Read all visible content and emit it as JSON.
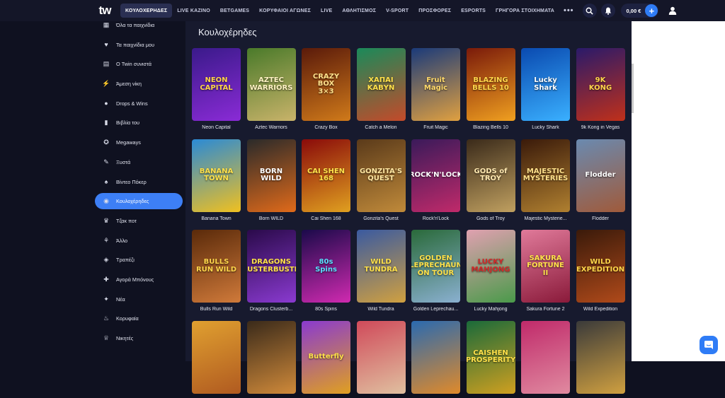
{
  "header": {
    "logo": "tw",
    "nav": [
      {
        "label": "ΚΟΥΛΟΧΕΡΗΔΕΣ",
        "active": true
      },
      {
        "label": "LIVE ΚΑΖΙΝΟ"
      },
      {
        "label": "BETGAMES"
      },
      {
        "label": "ΚΟΡΥΦΑΙΟΙ ΑΓΩΝΕΣ"
      },
      {
        "label": "LIVE"
      },
      {
        "label": "ΑΘΛΗΤΙΣΜΟΣ"
      },
      {
        "label": "V-SPORT"
      },
      {
        "label": "ΠΡΟΣΦΟΡΕΣ"
      },
      {
        "label": "ESPORTS"
      },
      {
        "label": "ΓΡΗΓΟΡΑ ΣΤΟΙΧΗΜΑΤΑ"
      }
    ],
    "more": "•••",
    "balance": "0,00 €",
    "plus": "+"
  },
  "sidebar": {
    "items": [
      {
        "label": "Όλα τα παιχνίδια",
        "icon": "grid-icon"
      },
      {
        "label": "Τα παιχνίδια μου",
        "icon": "heart-icon"
      },
      {
        "label": "Ο Twin συνιστά",
        "icon": "reels-icon"
      },
      {
        "label": "Άμεση νίκη",
        "icon": "lightning-icon"
      },
      {
        "label": "Drops & Wins",
        "icon": "drop-icon"
      },
      {
        "label": "Βιβλία του",
        "icon": "book-icon"
      },
      {
        "label": "Megaways",
        "icon": "megaways-icon"
      },
      {
        "label": "Ξυστά",
        "icon": "scratch-icon"
      },
      {
        "label": "Βίντεο Πόκερ",
        "icon": "cards-icon"
      },
      {
        "label": "Κουλοχέρηδες",
        "icon": "slot-icon",
        "active": true
      },
      {
        "label": "Τζακ ποτ",
        "icon": "jackpot-icon"
      },
      {
        "label": "Άλλο",
        "icon": "other-icon"
      },
      {
        "label": "Τραπέζι",
        "icon": "table-icon"
      },
      {
        "label": "Αγορά Μπόνους",
        "icon": "gift-icon"
      },
      {
        "label": "Νέα",
        "icon": "new-icon"
      },
      {
        "label": "Κορυφαία",
        "icon": "fire-icon"
      },
      {
        "label": "Νικητές",
        "icon": "trophy-icon"
      }
    ]
  },
  "main": {
    "title": "Κουλοχέρηδες",
    "games": [
      {
        "name": "Neon Capital",
        "art": "NEON\nCAPITAL",
        "colors": [
          "#3a1a8a",
          "#8a2bd6"
        ],
        "accent": "#ffd54a"
      },
      {
        "name": "Aztec Warriors",
        "art": "AZTEC\nWARRIORS",
        "colors": [
          "#4a7a2a",
          "#c9b36a"
        ],
        "accent": "#fff3c4"
      },
      {
        "name": "Crazy Box",
        "art": "CRAZY\nBOX\n3×3",
        "colors": [
          "#5a1a0a",
          "#d07a1a"
        ],
        "accent": "#ffe08a"
      },
      {
        "name": "Catch a Melon",
        "art": "ΧΑΠΑΙ\nΚΑΒΥΝ",
        "colors": [
          "#1a8a5a",
          "#c44a2a"
        ],
        "accent": "#ffe14a"
      },
      {
        "name": "Fruit Magic",
        "art": "Fruit Magic",
        "colors": [
          "#1a3a7a",
          "#e0a040"
        ],
        "accent": "#ffd96a"
      },
      {
        "name": "Blazing Bells 10",
        "art": "BLAZING\nBELLS 10",
        "colors": [
          "#7a1a0a",
          "#f0a020"
        ],
        "accent": "#ffd54a"
      },
      {
        "name": "Lucky Shark",
        "art": "Lucky\nShark",
        "colors": [
          "#0a4ab0",
          "#3ab0ff"
        ],
        "accent": "#ffffff"
      },
      {
        "name": "9k Kong in Vegas",
        "art": "9K\nKONG",
        "colors": [
          "#2a1a6a",
          "#c0301a"
        ],
        "accent": "#ffd54a"
      },
      {
        "name": "Banana Town",
        "art": "BANANA\nTOWN",
        "colors": [
          "#2a8ad6",
          "#f0c020"
        ],
        "accent": "#ffe14a"
      },
      {
        "name": "Born WILD",
        "art": "BORN WILD",
        "colors": [
          "#2a2a2a",
          "#e06a1a"
        ],
        "accent": "#ffffff"
      },
      {
        "name": "Cai Shen 168",
        "art": "CAI SHEN\n168",
        "colors": [
          "#8a0a0a",
          "#e0a020"
        ],
        "accent": "#ffe14a"
      },
      {
        "name": "Gonzita's Quest",
        "art": "GONZITA'S\nQUEST",
        "colors": [
          "#5a3a1a",
          "#c08a3a"
        ],
        "accent": "#ffe6a0"
      },
      {
        "name": "Rock'n'Lock",
        "art": "ROCK'N'LOCK",
        "colors": [
          "#3a1a5a",
          "#c02a6a"
        ],
        "accent": "#ffffff"
      },
      {
        "name": "Gods of Troy",
        "art": "GODS of\nTROY",
        "colors": [
          "#3a2a1a",
          "#c0a060"
        ],
        "accent": "#ffe8b0"
      },
      {
        "name": "Majestic Mysterie...",
        "art": "MAJESTIC\nMYSTERIES",
        "colors": [
          "#3a1a0a",
          "#b08030"
        ],
        "accent": "#ffe08a"
      },
      {
        "name": "Flodder",
        "art": "Flodder",
        "colors": [
          "#6a8ab0",
          "#a05a3a"
        ],
        "accent": "#ffffff"
      },
      {
        "name": "Bulls Run Wild",
        "art": "BULLS\nRUN WILD",
        "colors": [
          "#5a2a0a",
          "#d07a3a"
        ],
        "accent": "#ffd54a"
      },
      {
        "name": "Dragons Clusterb...",
        "art": "DRAGONS\nCLUSTERBUSTER",
        "colors": [
          "#2a0a4a",
          "#8a3ad0"
        ],
        "accent": "#ffe14a"
      },
      {
        "name": "80s Spins",
        "art": "80s\nSpins",
        "colors": [
          "#1a0a4a",
          "#d02ab0"
        ],
        "accent": "#5ae0ff"
      },
      {
        "name": "Wild Tundra",
        "art": "WILD\nTUNDRA",
        "colors": [
          "#3a5aa0",
          "#d0a040"
        ],
        "accent": "#ffe14a"
      },
      {
        "name": "Golden Leprechau...",
        "art": "GOLDEN\nLEPRECHAUN\nON TOUR",
        "colors": [
          "#2a6a3a",
          "#8ab0d0"
        ],
        "accent": "#ffe14a"
      },
      {
        "name": "Lucky Mahjong",
        "art": "LUCKY\nMAHJONG",
        "colors": [
          "#e0a0b0",
          "#4a9a4a"
        ],
        "accent": "#d02a2a"
      },
      {
        "name": "Sakura Fortune 2",
        "art": "SAKURA\nFORTUNE\nII",
        "colors": [
          "#e07a9a",
          "#8a1a3a"
        ],
        "accent": "#ffe14a"
      },
      {
        "name": "Wild Expedition",
        "art": "WILD\nEXPEDITION",
        "colors": [
          "#3a1a0a",
          "#b04a1a"
        ],
        "accent": "#ffd54a"
      },
      {
        "name": "",
        "art": "",
        "colors": [
          "#e0a030",
          "#b05a20"
        ],
        "accent": "#ffffff"
      },
      {
        "name": "",
        "art": "",
        "colors": [
          "#3a2a1a",
          "#d08a3a"
        ],
        "accent": "#ffffff"
      },
      {
        "name": "",
        "art": "Butterfly",
        "colors": [
          "#8a3ad0",
          "#e0a020"
        ],
        "accent": "#ffe14a"
      },
      {
        "name": "",
        "art": "",
        "colors": [
          "#d04a5a",
          "#e0c0a0"
        ],
        "accent": "#ffffff"
      },
      {
        "name": "",
        "art": "",
        "colors": [
          "#2a6ab0",
          "#e08a2a"
        ],
        "accent": "#ffffff"
      },
      {
        "name": "",
        "art": "CAISHEN\nPROSPERITY",
        "colors": [
          "#1a6a3a",
          "#d0a020"
        ],
        "accent": "#ffe14a"
      },
      {
        "name": "",
        "art": "",
        "colors": [
          "#c02a6a",
          "#e08aa0"
        ],
        "accent": "#ffffff"
      },
      {
        "name": "",
        "art": "",
        "colors": [
          "#3a3a3a",
          "#d0a040"
        ],
        "accent": "#ffffff"
      }
    ]
  }
}
